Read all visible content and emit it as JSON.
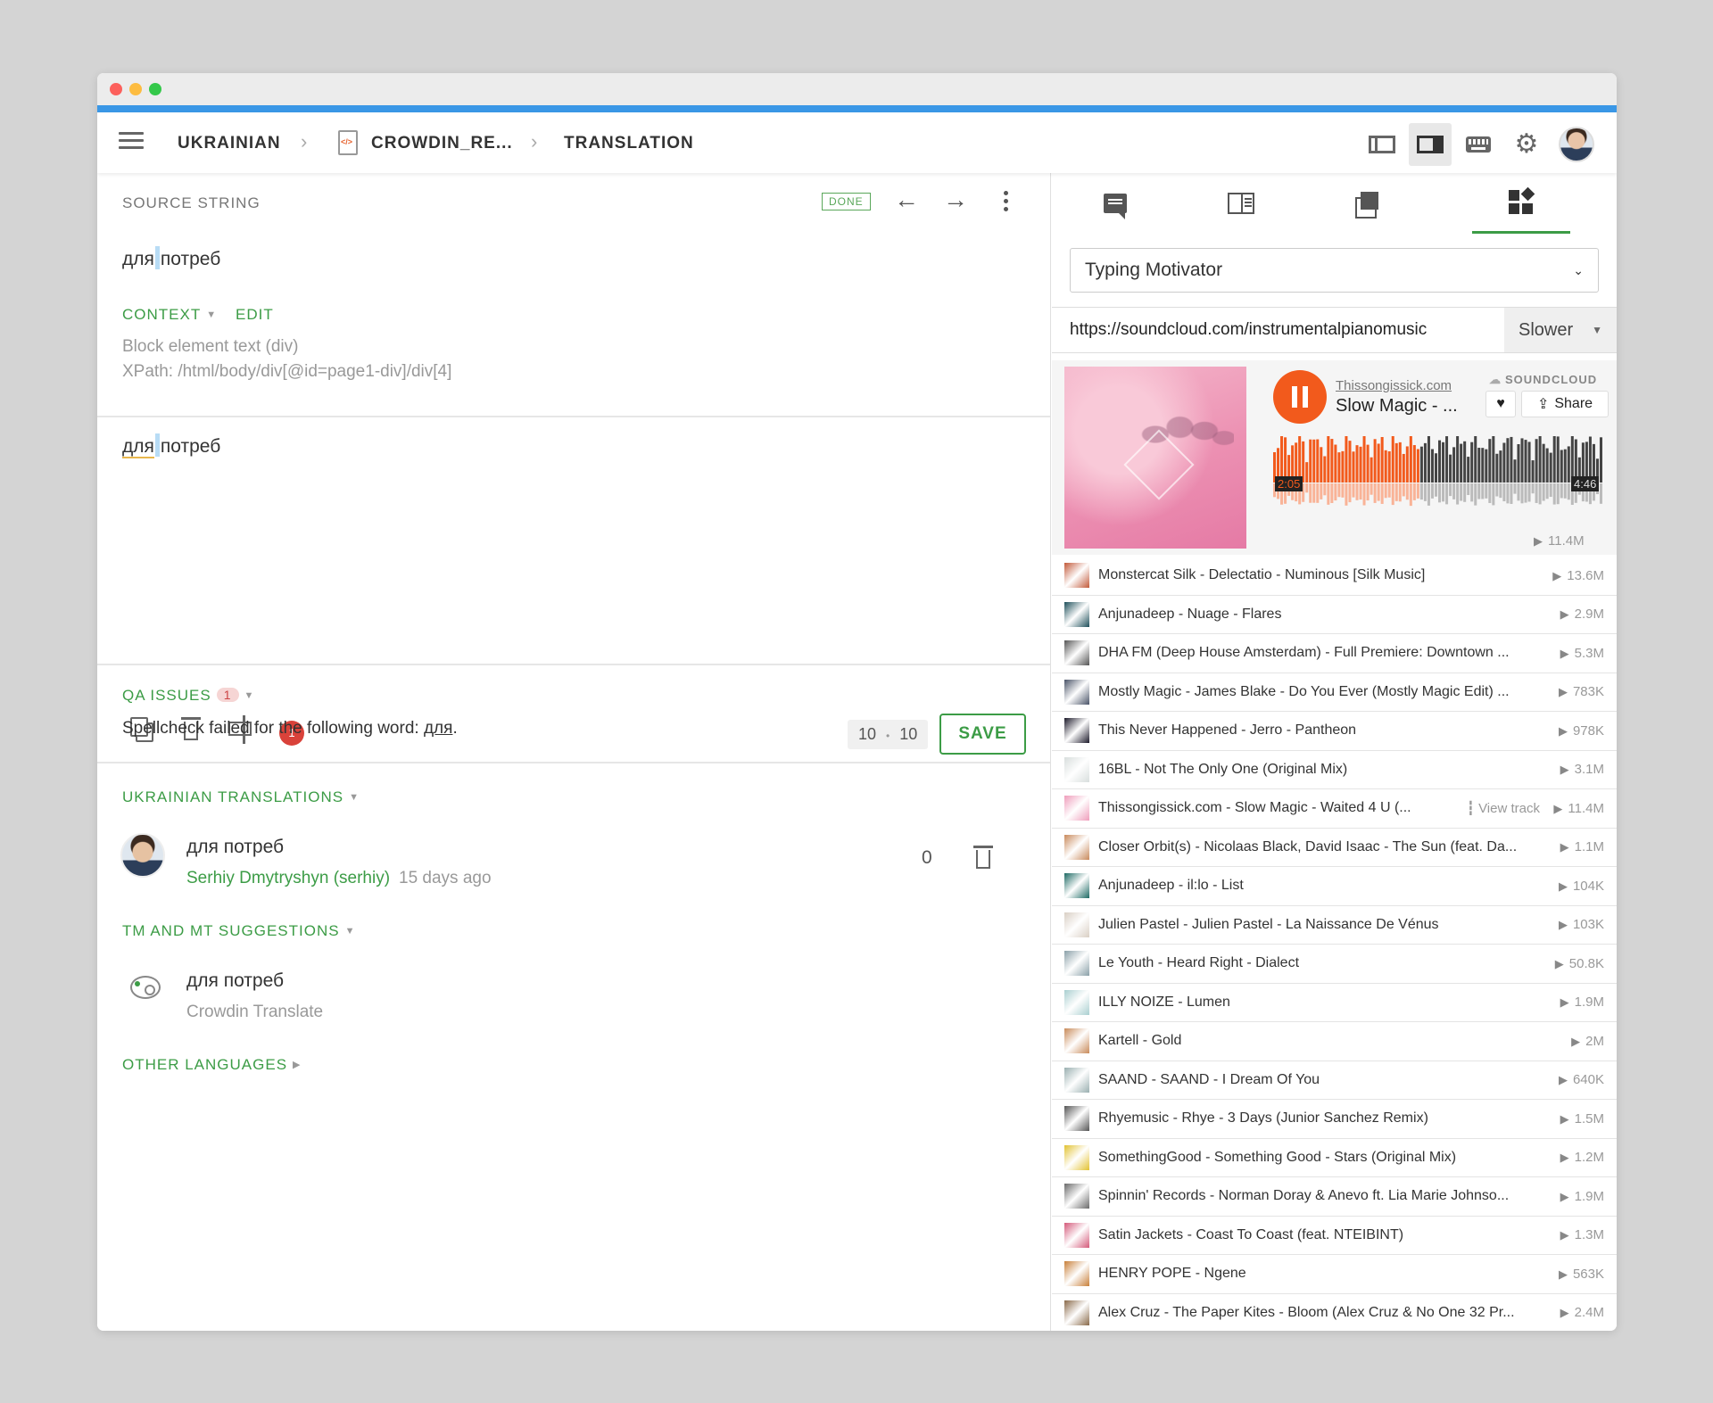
{
  "breadcrumb": {
    "language": "UKRAINIAN",
    "file": "CROWDIN_RE...",
    "section": "TRANSLATION"
  },
  "source": {
    "heading": "SOURCE STRING",
    "status": "DONE",
    "text_part1": "для",
    "text_part2": "потреб",
    "context_label": "CONTEXT",
    "edit_label": "EDIT",
    "context_line1": "Block element text (div)",
    "context_line2": "XPath: /html/body/div[@id=page1-div]/div[4]"
  },
  "editor": {
    "text_part1": "для",
    "text_part2": "потреб",
    "issue_count": "1",
    "counter_left": "10",
    "counter_sep": "•",
    "counter_right": "10",
    "save_label": "SAVE"
  },
  "qa": {
    "heading": "QA ISSUES",
    "count": "1",
    "message_prefix": "Spellcheck failed for the following word: ",
    "message_word": "для",
    "message_suffix": "."
  },
  "translations": {
    "heading": "UKRAINIAN TRANSLATIONS",
    "items": [
      {
        "text": "для потреб",
        "author": "Serhiy Dmytryshyn (serhiy)",
        "time": "15 days ago",
        "votes": "0"
      }
    ]
  },
  "suggestions": {
    "heading": "TM AND MT SUGGESTIONS",
    "items": [
      {
        "text": "для потреб",
        "source": "Crowdin Translate"
      }
    ]
  },
  "other_languages": {
    "heading": "OTHER LANGUAGES"
  },
  "right_panel": {
    "select_value": "Typing Motivator",
    "url": "https://soundcloud.com/instrumentalpianomusic",
    "speed": "Slower",
    "player": {
      "user": "Thissongissick.com",
      "title": "Slow Magic - ...",
      "brand": "SOUNDCLOUD",
      "share_label": "Share",
      "time_elapsed": "2:05",
      "time_total": "4:46",
      "progress": 0.44,
      "plays": "11.4M"
    },
    "tracks": [
      {
        "title": "Monstercat Silk - Delectatio - Numinous [Silk Music]",
        "plays": "13.6M",
        "color": "#c25a3a"
      },
      {
        "title": "Anjunadeep - Nuage - Flares",
        "plays": "2.9M",
        "color": "#1e4f5a"
      },
      {
        "title": "DHA FM (Deep House Amsterdam) - Full Premiere: Downtown ...",
        "plays": "5.3M",
        "color": "#555555"
      },
      {
        "title": "Mostly Magic - James Blake - Do You Ever (Mostly Magic Edit) ...",
        "plays": "783K",
        "color": "#4a5468"
      },
      {
        "title": "This Never Happened - Jerro - Pantheon",
        "plays": "978K",
        "color": "#1c1a2a"
      },
      {
        "title": "16BL - Not The Only One (Original Mix)",
        "plays": "3.1M",
        "color": "#d8dedd"
      },
      {
        "title": "Thissongissick.com - Slow Magic - Waited 4 U (...",
        "plays": "11.4M",
        "color": "#ef9dbb",
        "view_track": "View track"
      },
      {
        "title": "Closer Orbit(s) - Nicolaas Black, David Isaac - The Sun (feat. Da...",
        "plays": "1.1M",
        "color": "#c98a5c"
      },
      {
        "title": "Anjunadeep - il:lo - List",
        "plays": "104K",
        "color": "#1e6a64"
      },
      {
        "title": "Julien Pastel - Julien Pastel - La Naissance De Vénus",
        "plays": "103K",
        "color": "#d9cfc4"
      },
      {
        "title": "Le Youth - Heard Right - Dialect",
        "plays": "50.8K",
        "color": "#8aa0a8"
      },
      {
        "title": "ILLY NOIZE - Lumen",
        "plays": "1.9M",
        "color": "#a9cfd0"
      },
      {
        "title": "Kartell - Gold",
        "plays": "2M",
        "color": "#c98b5a"
      },
      {
        "title": "SAAND - SAAND - I Dream Of You",
        "plays": "640K",
        "color": "#9aafb0"
      },
      {
        "title": "Rhyemusic - Rhye - 3 Days (Junior Sanchez Remix)",
        "plays": "1.5M",
        "color": "#555555"
      },
      {
        "title": "SomethingGood - Something Good - Stars (Original Mix)",
        "plays": "1.2M",
        "color": "#e2c232"
      },
      {
        "title": "Spinnin' Records - Norman Doray & Anevo ft. Lia Marie Johnso...",
        "plays": "1.9M",
        "color": "#6a6a6a"
      },
      {
        "title": "Satin Jackets - Coast To Coast (feat. NTEIBINT)",
        "plays": "1.3M",
        "color": "#d45a7a"
      },
      {
        "title": "HENRY POPE - Ngene",
        "plays": "563K",
        "color": "#c8803a"
      },
      {
        "title": "Alex Cruz - The Paper Kites - Bloom (Alex Cruz & No One 32 Pr...",
        "plays": "2.4M",
        "color": "#8a6a4a"
      }
    ]
  }
}
